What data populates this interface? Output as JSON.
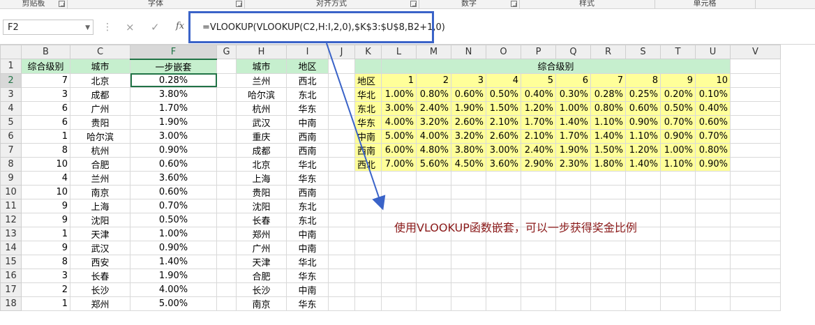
{
  "ribbon": {
    "groups": [
      "剪贴板",
      "字体",
      "对齐方式",
      "数字",
      "样式",
      "单元格"
    ]
  },
  "formula_bar": {
    "name_box": "F2",
    "cancel_icon": "×",
    "enter_icon": "✓",
    "fx_label": "fx",
    "formula": "=VLOOKUP(VLOOKUP(C2,H:I,2,0),$K$3:$U$8,B2+1,0)"
  },
  "columns": [
    "B",
    "C",
    "F",
    "G",
    "H",
    "I",
    "J",
    "K",
    "L",
    "M",
    "N",
    "O",
    "P",
    "Q",
    "R",
    "S",
    "T",
    "U",
    "V"
  ],
  "row_numbers": [
    "1",
    "2",
    "3",
    "4",
    "5",
    "6",
    "7",
    "8",
    "9",
    "10",
    "11",
    "12",
    "13",
    "14",
    "15",
    "16",
    "17",
    "18"
  ],
  "left_table": {
    "headers": [
      "综合级别",
      "城市",
      "一步嵌套"
    ],
    "rows": [
      [
        "7",
        "北京",
        "0.28%"
      ],
      [
        "3",
        "成都",
        "3.80%"
      ],
      [
        "6",
        "广州",
        "1.70%"
      ],
      [
        "6",
        "贵阳",
        "1.90%"
      ],
      [
        "1",
        "哈尔滨",
        "3.00%"
      ],
      [
        "8",
        "杭州",
        "0.90%"
      ],
      [
        "10",
        "合肥",
        "0.60%"
      ],
      [
        "4",
        "兰州",
        "3.60%"
      ],
      [
        "10",
        "南京",
        "0.60%"
      ],
      [
        "9",
        "上海",
        "0.70%"
      ],
      [
        "9",
        "沈阳",
        "0.50%"
      ],
      [
        "1",
        "天津",
        "1.00%"
      ],
      [
        "9",
        "武汉",
        "0.90%"
      ],
      [
        "8",
        "西安",
        "1.40%"
      ],
      [
        "3",
        "长春",
        "1.90%"
      ],
      [
        "2",
        "长沙",
        "4.00%"
      ],
      [
        "1",
        "郑州",
        "5.00%"
      ]
    ]
  },
  "mid_table": {
    "headers": [
      "城市",
      "地区"
    ],
    "rows": [
      [
        "兰州",
        "西北"
      ],
      [
        "哈尔滨",
        "东北"
      ],
      [
        "杭州",
        "华东"
      ],
      [
        "武汉",
        "中南"
      ],
      [
        "重庆",
        "西南"
      ],
      [
        "成都",
        "西南"
      ],
      [
        "北京",
        "华北"
      ],
      [
        "上海",
        "华东"
      ],
      [
        "贵阳",
        "西南"
      ],
      [
        "沈阳",
        "东北"
      ],
      [
        "长春",
        "东北"
      ],
      [
        "郑州",
        "中南"
      ],
      [
        "广州",
        "中南"
      ],
      [
        "天津",
        "华北"
      ],
      [
        "合肥",
        "华东"
      ],
      [
        "长沙",
        "中南"
      ],
      [
        "南京",
        "华东"
      ]
    ]
  },
  "right_table": {
    "title": "综合级别",
    "corner": "地区",
    "levels": [
      "1",
      "2",
      "3",
      "4",
      "5",
      "6",
      "7",
      "8",
      "9",
      "10"
    ],
    "rows": [
      {
        "region": "华北",
        "values": [
          "1.00%",
          "0.80%",
          "0.60%",
          "0.50%",
          "0.40%",
          "0.30%",
          "0.28%",
          "0.25%",
          "0.20%",
          "0.10%"
        ]
      },
      {
        "region": "东北",
        "values": [
          "3.00%",
          "2.40%",
          "1.90%",
          "1.50%",
          "1.20%",
          "1.00%",
          "0.80%",
          "0.60%",
          "0.50%",
          "0.40%"
        ]
      },
      {
        "region": "华东",
        "values": [
          "4.00%",
          "3.20%",
          "2.60%",
          "2.10%",
          "1.70%",
          "1.40%",
          "1.10%",
          "0.90%",
          "0.70%",
          "0.60%"
        ]
      },
      {
        "region": "中南",
        "values": [
          "5.00%",
          "4.00%",
          "3.20%",
          "2.60%",
          "2.10%",
          "1.70%",
          "1.40%",
          "1.10%",
          "0.90%",
          "0.70%"
        ]
      },
      {
        "region": "西南",
        "values": [
          "6.00%",
          "4.80%",
          "3.80%",
          "3.00%",
          "2.40%",
          "1.90%",
          "1.50%",
          "1.20%",
          "1.00%",
          "0.80%"
        ]
      },
      {
        "region": "西北",
        "values": [
          "7.00%",
          "5.60%",
          "4.50%",
          "3.60%",
          "2.90%",
          "2.30%",
          "1.80%",
          "1.40%",
          "1.10%",
          "0.90%"
        ]
      }
    ]
  },
  "annotation": "使用VLOOKUP函数嵌套，可以一步获得奖金比例",
  "colors": {
    "header_green": "#c6efce",
    "table_yellow": "#ffff99",
    "highlight_blue": "#3a63c8",
    "annotation_red": "#8b1a1a",
    "selection_green": "#217346"
  }
}
